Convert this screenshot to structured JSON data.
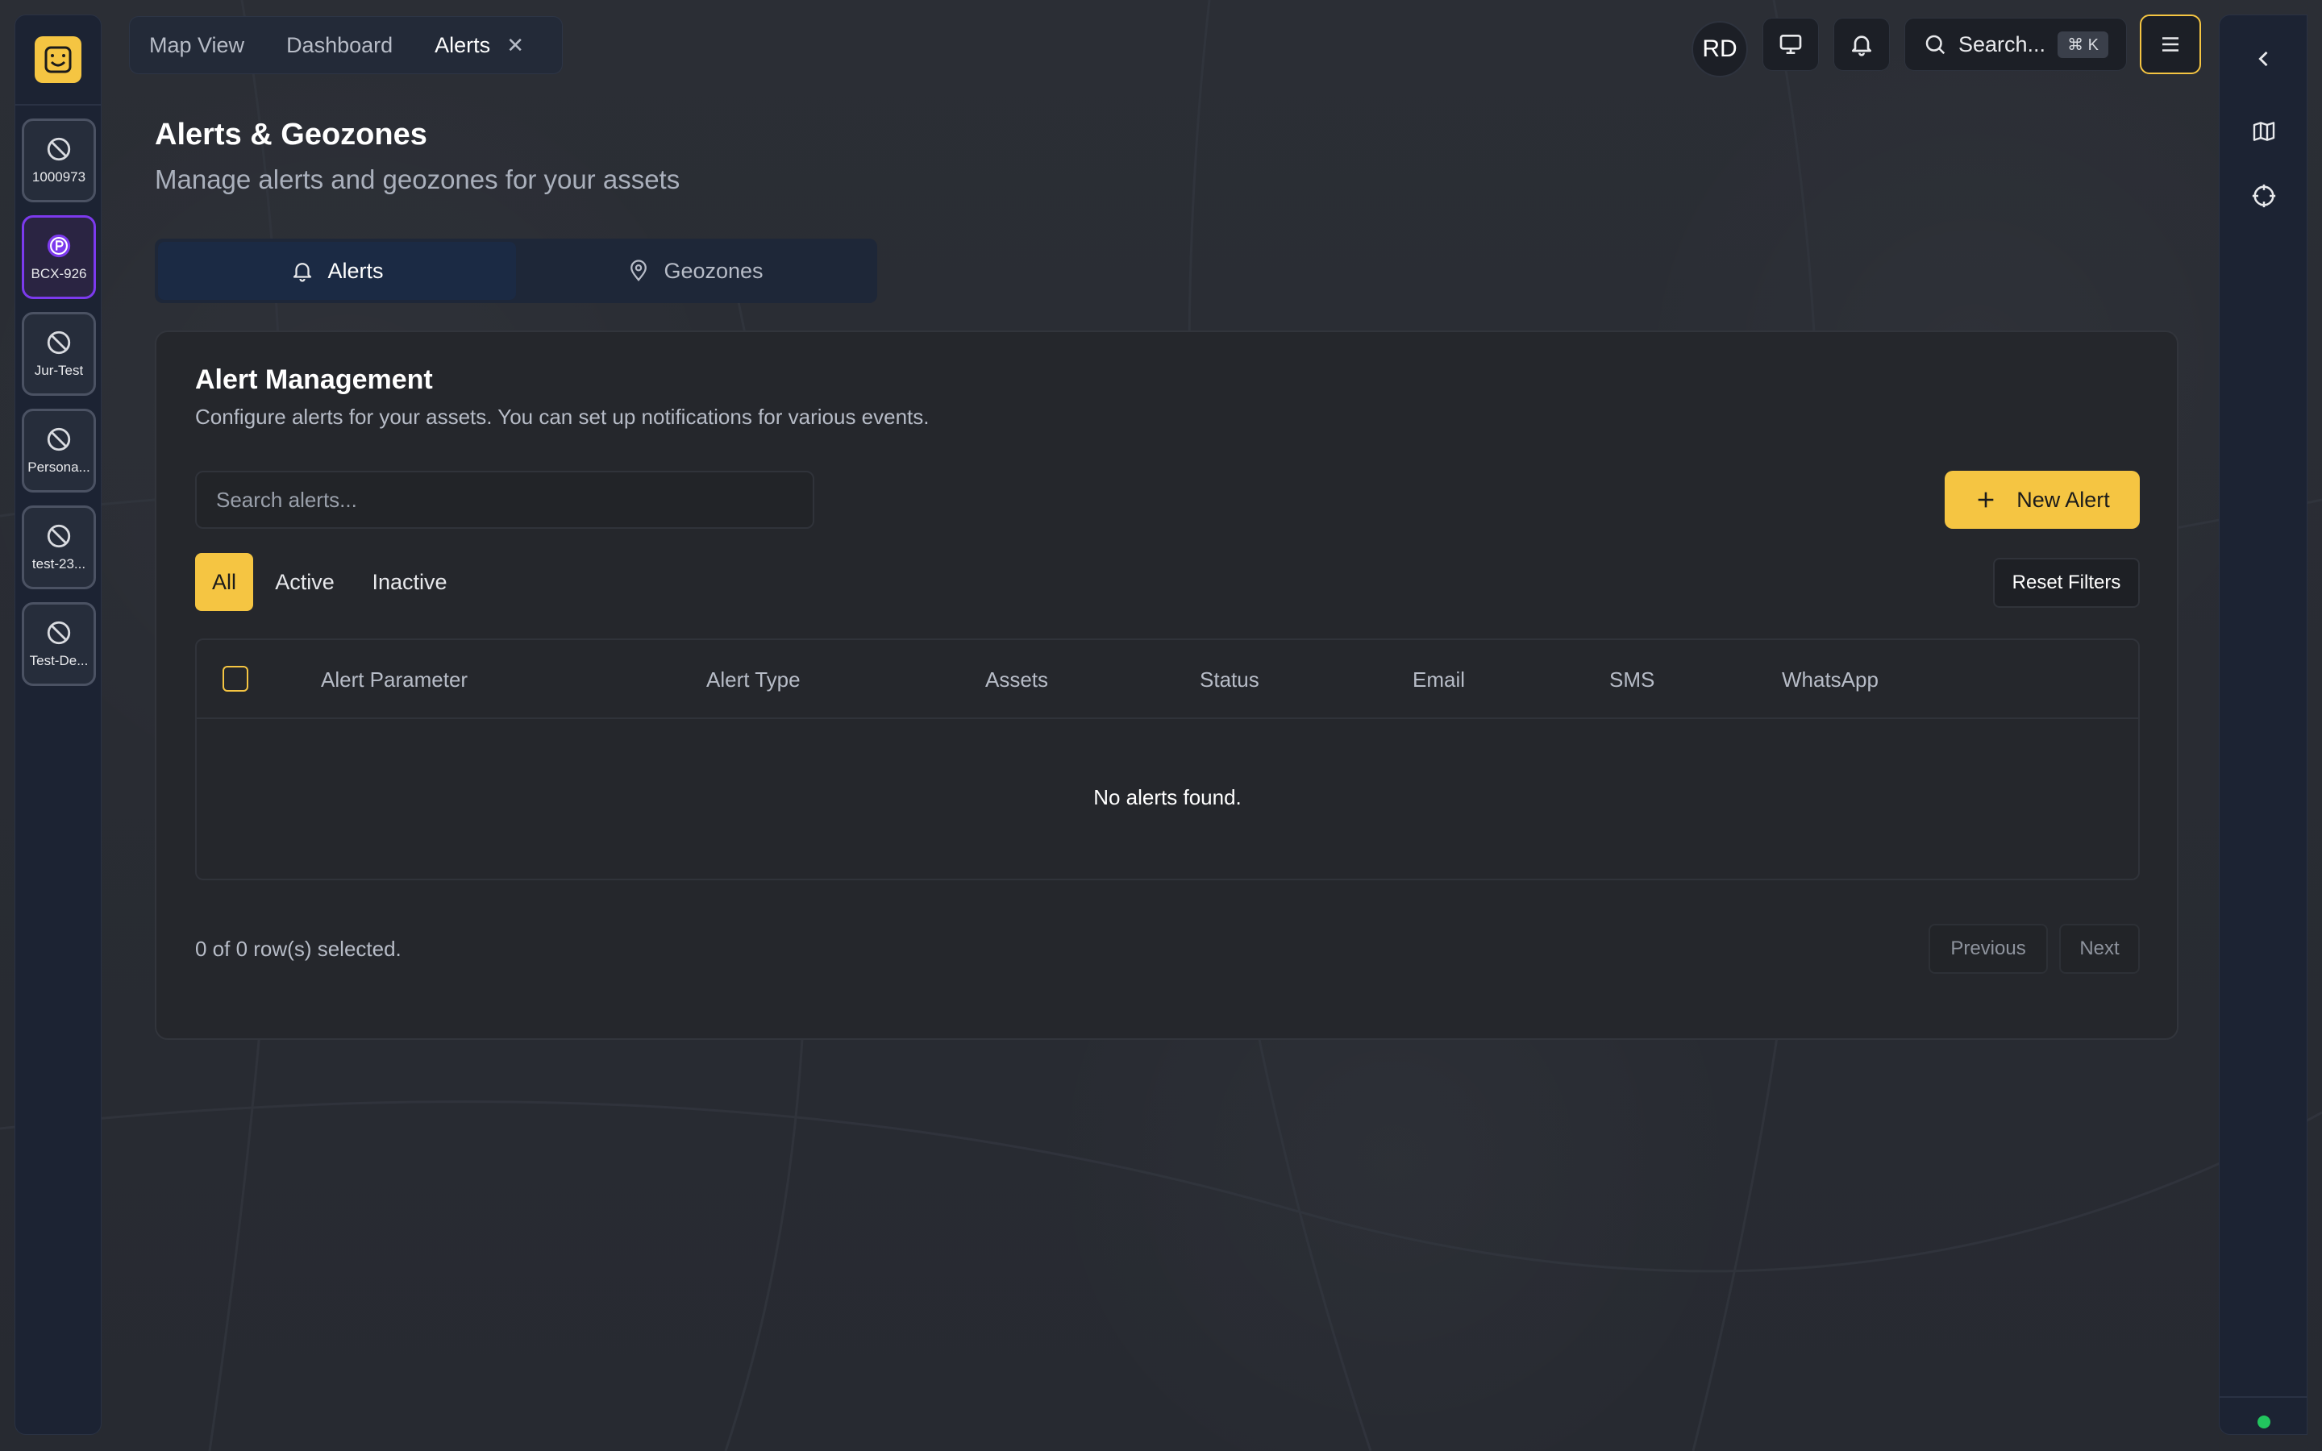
{
  "assets": [
    {
      "label": "1000973",
      "icon": "offline-icon",
      "selected": false
    },
    {
      "label": "BCX-926",
      "icon": "parking-icon",
      "selected": true
    },
    {
      "label": "Jur-Test",
      "icon": "offline-icon",
      "selected": false
    },
    {
      "label": "Persona...",
      "icon": "offline-icon",
      "selected": false
    },
    {
      "label": "test-23...",
      "icon": "offline-icon",
      "selected": false
    },
    {
      "label": "Test-De...",
      "icon": "offline-icon",
      "selected": false
    }
  ],
  "top_tabs": {
    "map_view": "Map View",
    "dashboard": "Dashboard",
    "alerts": "Alerts"
  },
  "toolbar": {
    "avatar_initials": "RD",
    "search_label": "Search...",
    "search_shortcut": "⌘ K"
  },
  "page": {
    "title": "Alerts & Geozones",
    "subtitle": "Manage alerts and geozones for your assets"
  },
  "section_tabs": {
    "alerts": "Alerts",
    "geozones": "Geozones"
  },
  "card": {
    "title": "Alert Management",
    "description": "Configure alerts for your assets. You can set up notifications for various events.",
    "search_placeholder": "Search alerts...",
    "new_alert_label": "New Alert",
    "filters": {
      "all": "All",
      "active": "Active",
      "inactive": "Inactive"
    },
    "reset_label": "Reset Filters",
    "columns": [
      "Alert Parameter",
      "Alert Type",
      "Assets",
      "Status",
      "Email",
      "SMS",
      "WhatsApp"
    ],
    "empty_message": "No alerts found.",
    "selection_text": "0 of 0 row(s) selected.",
    "previous_label": "Previous",
    "next_label": "Next"
  },
  "colors": {
    "accent": "#f5c542",
    "selected_asset": "#7c3aed",
    "online_status": "#22c55e"
  }
}
